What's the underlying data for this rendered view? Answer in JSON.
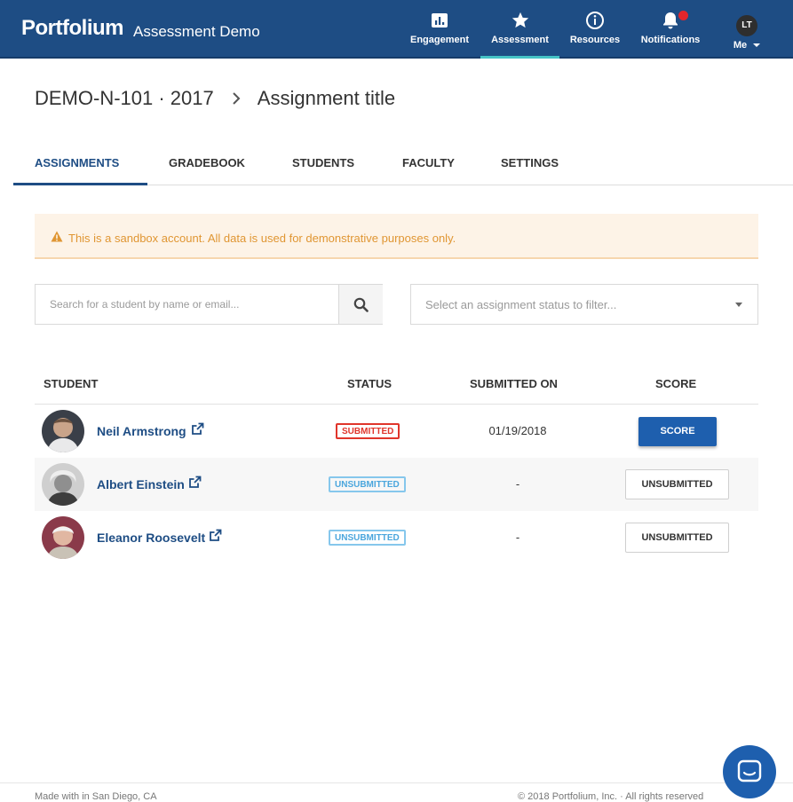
{
  "header": {
    "brand": "Portfolium",
    "app_title": "Assessment Demo",
    "nav": [
      {
        "label": "Engagement",
        "icon": "bar-chart-icon"
      },
      {
        "label": "Assessment",
        "icon": "star-icon"
      },
      {
        "label": "Resources",
        "icon": "info-icon"
      },
      {
        "label": "Notifications",
        "icon": "bell-icon"
      }
    ],
    "user_initials": "LT",
    "me_label": "Me"
  },
  "breadcrumb": {
    "course": "DEMO-N-101 · 2017",
    "page": "Assignment title"
  },
  "tabs": [
    "ASSIGNMENTS",
    "GRADEBOOK",
    "STUDENTS",
    "FACULTY",
    "SETTINGS"
  ],
  "alert": {
    "text": "This is a sandbox account. All data is used for demonstrative purposes only."
  },
  "search": {
    "placeholder": "Search for a student by name or email...",
    "value": ""
  },
  "status_filter": {
    "placeholder": "Select an assignment status to filter..."
  },
  "table": {
    "headers": [
      "STUDENT",
      "STATUS",
      "SUBMITTED ON",
      "SCORE"
    ],
    "rows": [
      {
        "name": "Neil Armstrong",
        "status": "SUBMITTED",
        "submitted_on": "01/19/2018",
        "score": "SCORE"
      },
      {
        "name": "Albert Einstein",
        "status": "UNSUBMITTED",
        "submitted_on": "-",
        "score": "UNSUBMITTED"
      },
      {
        "name": "Eleanor Roosevelt",
        "status": "UNSUBMITTED",
        "submitted_on": "-",
        "score": "UNSUBMITTED"
      }
    ]
  },
  "footer": {
    "left": "Made with  in San Diego, CA",
    "right": "© 2018 Portfolium, Inc. · All rights reserved"
  },
  "colors": {
    "header_bg": "#1e4d84",
    "accent": "#45c3c6",
    "submitted": "#e0352b",
    "unsubmitted": "#4ba6dd"
  }
}
